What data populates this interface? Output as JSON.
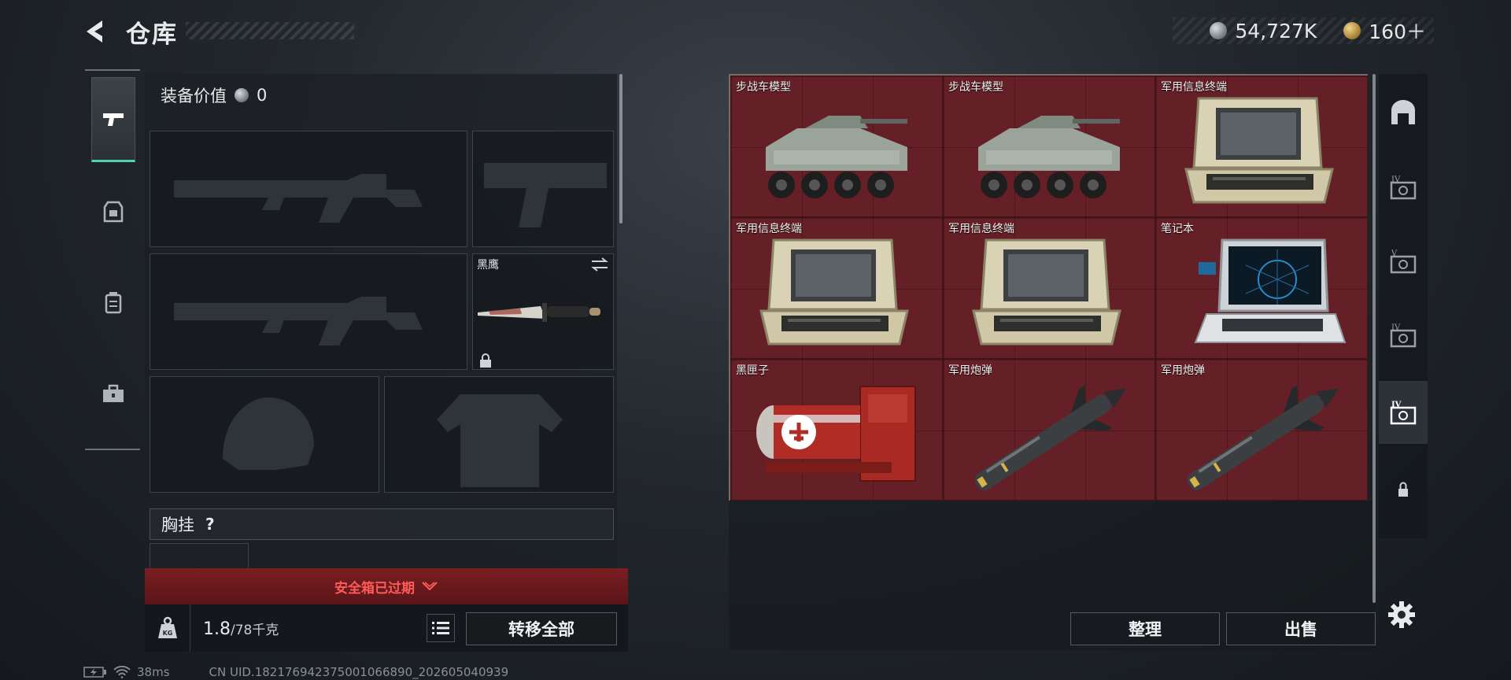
{
  "header": {
    "title": "仓库",
    "currency_primary": "54,727K",
    "currency_secondary": "160＋"
  },
  "equipment": {
    "value_label": "装备价值",
    "value": "0",
    "melee_slot_name": "黑鹰",
    "section_label": "胸挂",
    "help": "?",
    "safe_box_status": "安全箱已过期",
    "weight_current": "1.8",
    "weight_capacity": "/78千克",
    "transfer_all": "转移全部"
  },
  "storage": {
    "items": [
      {
        "name": "步战车模型",
        "icon": "ifv-model"
      },
      {
        "name": "步战车模型",
        "icon": "ifv-model"
      },
      {
        "name": "军用信息终端",
        "icon": "military-terminal"
      },
      {
        "name": "军用信息终端",
        "icon": "military-terminal"
      },
      {
        "name": "军用信息终端",
        "icon": "military-terminal"
      },
      {
        "name": "笔记本",
        "icon": "laptop"
      },
      {
        "name": "黑匣子",
        "icon": "black-box"
      },
      {
        "name": "军用炮弹",
        "icon": "artillery-shell"
      },
      {
        "name": "军用炮弹",
        "icon": "artillery-shell"
      }
    ],
    "sort": "整理",
    "sell": "出售"
  },
  "status": {
    "ping": "38ms",
    "uid": "CN UID.18217694237500106689​0_202605040939"
  },
  "rail": {
    "tabs": [
      "I",
      "IV",
      "V",
      "IV",
      "IV"
    ]
  },
  "colors": {
    "accent": "#4fd1b5",
    "item_cell": "#651f26",
    "alert": "#ff5a5a"
  }
}
